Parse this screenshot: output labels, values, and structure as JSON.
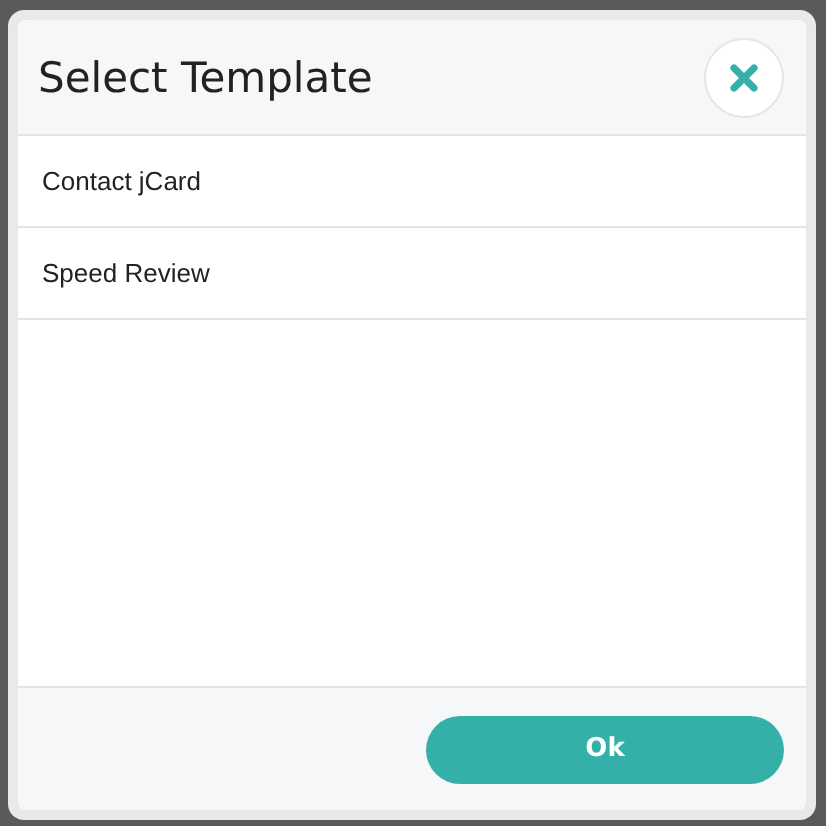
{
  "dialog": {
    "title": "Select Template"
  },
  "templates": [
    {
      "label": "Contact jCard"
    },
    {
      "label": "Speed Review"
    }
  ],
  "footer": {
    "button": "Ok"
  }
}
